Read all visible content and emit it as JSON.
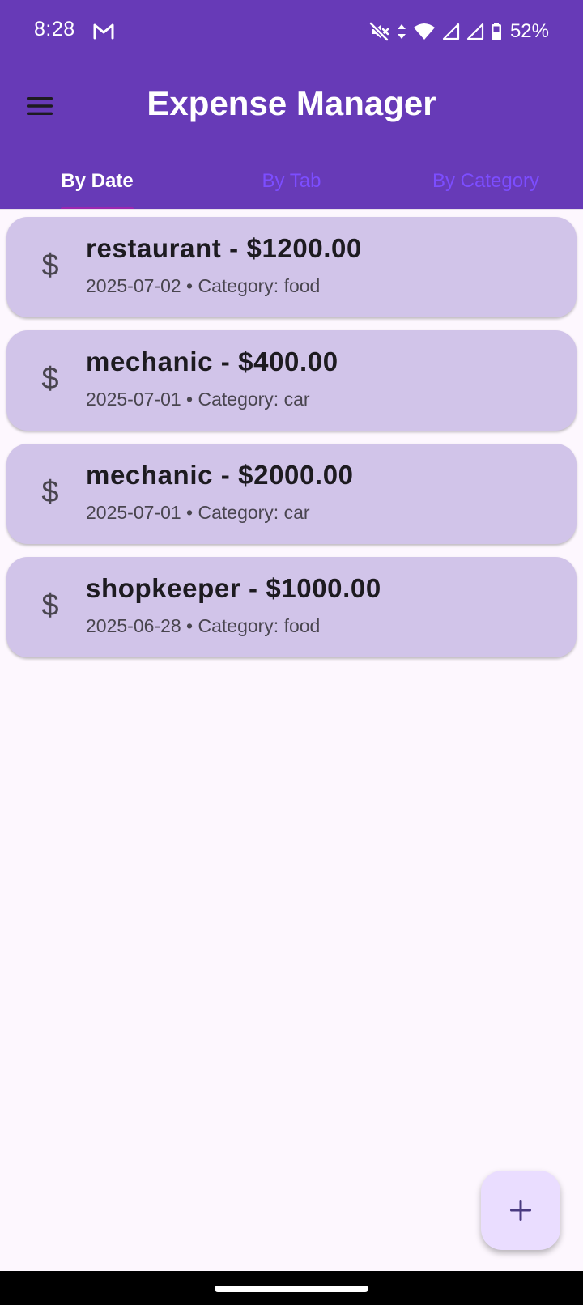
{
  "status_bar": {
    "time": "8:28",
    "battery": "52%",
    "icons": [
      "gmail-icon",
      "mute-icon",
      "data-arrows-icon",
      "wifi-icon",
      "signal-icon",
      "signal-icon",
      "battery-icon"
    ]
  },
  "app_bar": {
    "title": "Expense Manager",
    "menu_icon": "menu-icon",
    "background_color": "#673ab7"
  },
  "tabs": [
    {
      "label": "By Date",
      "active": true
    },
    {
      "label": "By Tab",
      "active": false
    },
    {
      "label": "By Category",
      "active": false
    }
  ],
  "expenses": [
    {
      "icon": "$",
      "title": "restaurant - $1200.00",
      "subtitle": "2025-07-02 • Category: food"
    },
    {
      "icon": "$",
      "title": "mechanic - $400.00",
      "subtitle": "2025-07-01 • Category: car"
    },
    {
      "icon": "$",
      "title": "mechanic - $2000.00",
      "subtitle": "2025-07-01 • Category: car"
    },
    {
      "icon": "$",
      "title": "shopkeeper - $1000.00",
      "subtitle": "2025-06-28 • Category: food"
    }
  ],
  "fab": {
    "icon": "add-icon"
  },
  "colors": {
    "accent": "#673ab7",
    "card": "#d1c4e9",
    "tab_indicator": "#9c27b0",
    "inactive_tab": "#7c4dff",
    "fab": "#eaddff"
  }
}
